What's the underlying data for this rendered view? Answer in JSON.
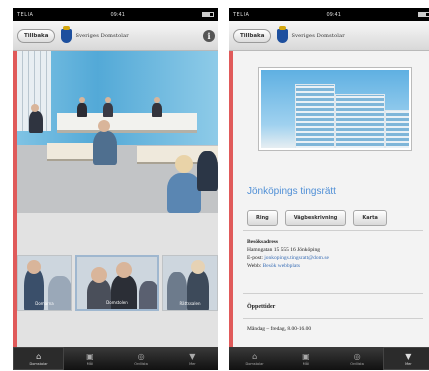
{
  "statusbar": {
    "carrier": "TELIA",
    "time": "09:41"
  },
  "left": {
    "back_label": "Tillbaka",
    "brand": "Sveriges Domstolar",
    "thumbnails": [
      {
        "caption": "Domarna"
      },
      {
        "caption": "Domstolen"
      },
      {
        "caption": "Rättssalen"
      }
    ]
  },
  "right": {
    "back_label": "Tillbaka",
    "brand": "Sveriges Domstolar",
    "title": "Jönköpings tingsrätt",
    "buttons": [
      "Ring",
      "Vägbeskrivning",
      "Karta"
    ],
    "visit_heading": "Besöksadress",
    "visit_address": "Hamngatan 15 555 16 Jönköping",
    "email_label": "E-post:",
    "email_value": "jonkopings.tingsratt@dom.se",
    "web_label": "Webb:",
    "web_value": "Besök webbplats",
    "hours_heading": "Öppettider",
    "hours_value": "Måndag – fredag, 8.00-16.00"
  },
  "tabbar": {
    "tabs": [
      {
        "label": "Domstolar",
        "icon": "courthouse-icon"
      },
      {
        "label": "Mål",
        "icon": "briefcase-icon"
      },
      {
        "label": "Ordlista",
        "icon": "book-icon"
      },
      {
        "label": "Mer",
        "icon": "filter-icon"
      }
    ]
  }
}
